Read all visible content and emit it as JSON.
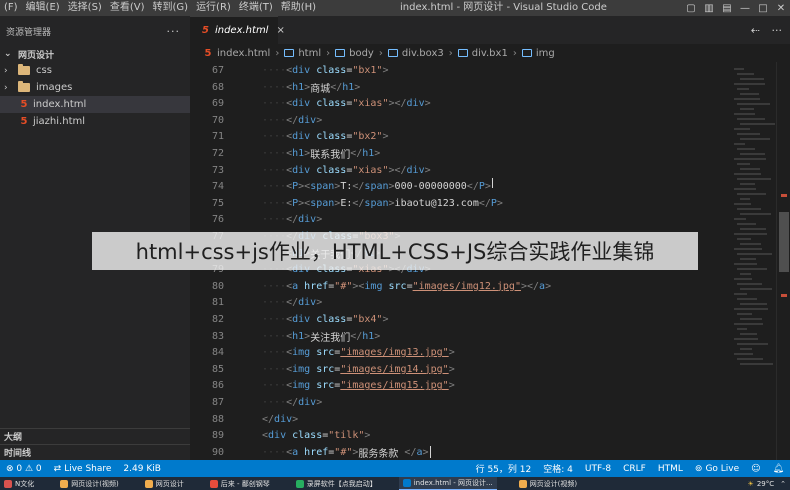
{
  "menu": [
    "(F)",
    "编辑(E)",
    "选择(S)",
    "查看(V)",
    "转到(G)",
    "运行(R)",
    "终端(T)",
    "帮助(H)"
  ],
  "window_title": "index.html - 网页设计 - Visual Studio Code",
  "sidebar": {
    "header": "资源管理器",
    "more": "···",
    "section": "网页设计",
    "items": [
      {
        "label": "css",
        "type": "folder"
      },
      {
        "label": "images",
        "type": "folder"
      },
      {
        "label": "index.html",
        "type": "html",
        "selected": true
      },
      {
        "label": "jiazhi.html",
        "type": "html"
      }
    ],
    "outline": "大纲",
    "timeline": "时间线"
  },
  "tab": {
    "label": "index.html",
    "close": "×"
  },
  "breadcrumb": [
    "index.html",
    "html",
    "body",
    "div.box3",
    "div.bx1",
    "img"
  ],
  "code_lines": [
    {
      "n": "67",
      "parts": [
        [
          "tag",
          "<"
        ],
        [
          "tn",
          "div"
        ],
        [
          "an",
          " class"
        ],
        [
          "txt",
          "="
        ],
        [
          "av",
          "\"bx1\""
        ],
        [
          "tag",
          ">"
        ]
      ]
    },
    {
      "n": "68",
      "parts": [
        [
          "tag",
          "<"
        ],
        [
          "tn",
          "h1"
        ],
        [
          "tag",
          ">"
        ],
        [
          "txt",
          "商城"
        ],
        [
          "tag",
          "</"
        ],
        [
          "tn",
          "h1"
        ],
        [
          "tag",
          ">"
        ]
      ]
    },
    {
      "n": "69",
      "parts": [
        [
          "tag",
          "<"
        ],
        [
          "tn",
          "div"
        ],
        [
          "an",
          " class"
        ],
        [
          "txt",
          "="
        ],
        [
          "av",
          "\"xias\""
        ],
        [
          "tag",
          "></"
        ],
        [
          "tn",
          "div"
        ],
        [
          "tag",
          ">"
        ]
      ]
    },
    {
      "n": "70",
      "parts": [
        [
          "tag",
          "</"
        ],
        [
          "tn",
          "div"
        ],
        [
          "tag",
          ">"
        ]
      ]
    },
    {
      "n": "71",
      "parts": [
        [
          "tag",
          "<"
        ],
        [
          "tn",
          "div"
        ],
        [
          "an",
          " class"
        ],
        [
          "txt",
          "="
        ],
        [
          "av",
          "\"bx2\""
        ],
        [
          "tag",
          ">"
        ]
      ]
    },
    {
      "n": "72",
      "parts": [
        [
          "tag",
          "<"
        ],
        [
          "tn",
          "h1"
        ],
        [
          "tag",
          ">"
        ],
        [
          "txt",
          "联系我们"
        ],
        [
          "tag",
          "</"
        ],
        [
          "tn",
          "h1"
        ],
        [
          "tag",
          ">"
        ]
      ]
    },
    {
      "n": "73",
      "parts": [
        [
          "tag",
          "<"
        ],
        [
          "tn",
          "div"
        ],
        [
          "an",
          " class"
        ],
        [
          "txt",
          "="
        ],
        [
          "av",
          "\"xias\""
        ],
        [
          "tag",
          "></"
        ],
        [
          "tn",
          "div"
        ],
        [
          "tag",
          ">"
        ]
      ]
    },
    {
      "n": "74",
      "parts": [
        [
          "tag",
          "<"
        ],
        [
          "tn",
          "P"
        ],
        [
          "tag",
          "><"
        ],
        [
          "tn",
          "span"
        ],
        [
          "tag",
          ">"
        ],
        [
          "txt",
          "T:"
        ],
        [
          "tag",
          "</"
        ],
        [
          "tn",
          "span"
        ],
        [
          "tag",
          ">"
        ],
        [
          "txt",
          "000-00000000"
        ],
        [
          "tag",
          "</"
        ],
        [
          "tn",
          "P"
        ],
        [
          "tag",
          ">"
        ]
      ]
    },
    {
      "n": "75",
      "parts": [
        [
          "tag",
          "<"
        ],
        [
          "tn",
          "P"
        ],
        [
          "tag",
          "><"
        ],
        [
          "tn",
          "span"
        ],
        [
          "tag",
          ">"
        ],
        [
          "txt",
          "E:"
        ],
        [
          "tag",
          "</"
        ],
        [
          "tn",
          "span"
        ],
        [
          "tag",
          ">"
        ],
        [
          "txt",
          "ibaotu@123.com"
        ],
        [
          "tag",
          "</"
        ],
        [
          "tn",
          "P"
        ],
        [
          "tag",
          ">"
        ]
      ]
    },
    {
      "n": "76",
      "parts": [
        [
          "tag",
          "</"
        ],
        [
          "tn",
          "div"
        ],
        [
          "tag",
          ">"
        ]
      ]
    },
    {
      "n": "77",
      "parts": [
        [
          "tag",
          "</"
        ],
        [
          "tn",
          "div"
        ],
        [
          "an",
          " class"
        ],
        [
          "txt",
          "="
        ],
        [
          "av",
          "\"box3\""
        ],
        [
          "tag",
          ">"
        ]
      ]
    },
    {
      "n": "78",
      "parts": [
        [
          "tag",
          "<"
        ],
        [
          "tn",
          "h1"
        ],
        [
          "tag",
          ">"
        ],
        [
          "txt",
          "关于我们"
        ],
        [
          "tag",
          "</"
        ],
        [
          "tn",
          "h1"
        ],
        [
          "tag",
          ">"
        ]
      ]
    },
    {
      "n": "79",
      "parts": [
        [
          "tag",
          "<"
        ],
        [
          "tn",
          "div"
        ],
        [
          "an",
          " class"
        ],
        [
          "txt",
          "="
        ],
        [
          "av",
          "\"xias\""
        ],
        [
          "tag",
          "></"
        ],
        [
          "tn",
          "div"
        ],
        [
          "tag",
          ">"
        ]
      ]
    },
    {
      "n": "80",
      "parts": [
        [
          "tag",
          "<"
        ],
        [
          "tn",
          "a"
        ],
        [
          "an",
          " href"
        ],
        [
          "txt",
          "="
        ],
        [
          "av",
          "\"#\""
        ],
        [
          "tag",
          "><"
        ],
        [
          "tn",
          "img"
        ],
        [
          "an",
          " src"
        ],
        [
          "txt",
          "="
        ],
        [
          "link",
          "\"images/img12.jpg\""
        ],
        [
          "tag",
          "></"
        ],
        [
          "tn",
          "a"
        ],
        [
          "tag",
          ">"
        ]
      ]
    },
    {
      "n": "81",
      "parts": [
        [
          "tag",
          "</"
        ],
        [
          "tn",
          "div"
        ],
        [
          "tag",
          ">"
        ]
      ]
    },
    {
      "n": "82",
      "parts": [
        [
          "tag",
          "<"
        ],
        [
          "tn",
          "div"
        ],
        [
          "an",
          " class"
        ],
        [
          "txt",
          "="
        ],
        [
          "av",
          "\"bx4\""
        ],
        [
          "tag",
          ">"
        ]
      ]
    },
    {
      "n": "83",
      "parts": [
        [
          "tag",
          "<"
        ],
        [
          "tn",
          "h1"
        ],
        [
          "tag",
          ">"
        ],
        [
          "txt",
          "关注我们"
        ],
        [
          "tag",
          "</"
        ],
        [
          "tn",
          "h1"
        ],
        [
          "tag",
          ">"
        ]
      ]
    },
    {
      "n": "84",
      "parts": [
        [
          "tag",
          "<"
        ],
        [
          "tn",
          "img"
        ],
        [
          "an",
          " src"
        ],
        [
          "txt",
          "="
        ],
        [
          "link",
          "\"images/img13.jpg\""
        ],
        [
          "tag",
          ">"
        ]
      ]
    },
    {
      "n": "85",
      "parts": [
        [
          "tag",
          "<"
        ],
        [
          "tn",
          "img"
        ],
        [
          "an",
          " src"
        ],
        [
          "txt",
          "="
        ],
        [
          "link",
          "\"images/img14.jpg\""
        ],
        [
          "tag",
          ">"
        ]
      ]
    },
    {
      "n": "86",
      "parts": [
        [
          "tag",
          "<"
        ],
        [
          "tn",
          "img"
        ],
        [
          "an",
          " src"
        ],
        [
          "txt",
          "="
        ],
        [
          "link",
          "\"images/img15.jpg\""
        ],
        [
          "tag",
          ">"
        ]
      ]
    },
    {
      "n": "87",
      "parts": [
        [
          "tag",
          "</"
        ],
        [
          "tn",
          "div"
        ],
        [
          "tag",
          ">"
        ]
      ]
    },
    {
      "n": "88",
      "parts": [
        [
          "tag",
          "</"
        ],
        [
          "tn",
          "div"
        ],
        [
          "tag",
          ">"
        ]
      ]
    },
    {
      "n": "89",
      "parts": [
        [
          "tag",
          "<"
        ],
        [
          "tn",
          "div"
        ],
        [
          "an",
          " class"
        ],
        [
          "txt",
          "="
        ],
        [
          "av",
          "\"tilk\""
        ],
        [
          "tag",
          ">"
        ]
      ]
    },
    {
      "n": "90",
      "parts": [
        [
          "tag",
          "<"
        ],
        [
          "tn",
          "a"
        ],
        [
          "an",
          " href"
        ],
        [
          "txt",
          "="
        ],
        [
          "av",
          "\"#\""
        ],
        [
          "tag",
          ">"
        ],
        [
          "txt",
          "服务条款 "
        ],
        [
          "tag",
          "</"
        ],
        [
          "tn",
          "a"
        ],
        [
          "tag",
          ">"
        ]
      ]
    }
  ],
  "banner": "html+css+js作业，HTML+CSS+JS综合实践作业集锦",
  "status": {
    "errors": "⊗ 0 ⚠ 0",
    "live_share": "Live Share",
    "size": "2.49 KiB",
    "position": "行 55，列 12",
    "spaces": "空格: 4",
    "encoding": "UTF-8",
    "eol": "CRLF",
    "language": "HTML",
    "golive": "Go Live"
  },
  "taskbar": {
    "items": [
      "N文化",
      "网页设计(视频)",
      "网页设计",
      "后来 - 鄱创钢琴",
      "录屏软件【点我启动】",
      "index.html - 网页设计...",
      "网页设计(视频)"
    ],
    "weather": "29°C",
    "accent": "#7ab3ff"
  },
  "colors": {
    "status_bar": "#007acc",
    "editor_bg": "#1e1e1e",
    "sidebar_bg": "#252526",
    "tag_name": "#569cd6",
    "attr_name": "#9cdcfe",
    "attr_value": "#ce9178"
  }
}
